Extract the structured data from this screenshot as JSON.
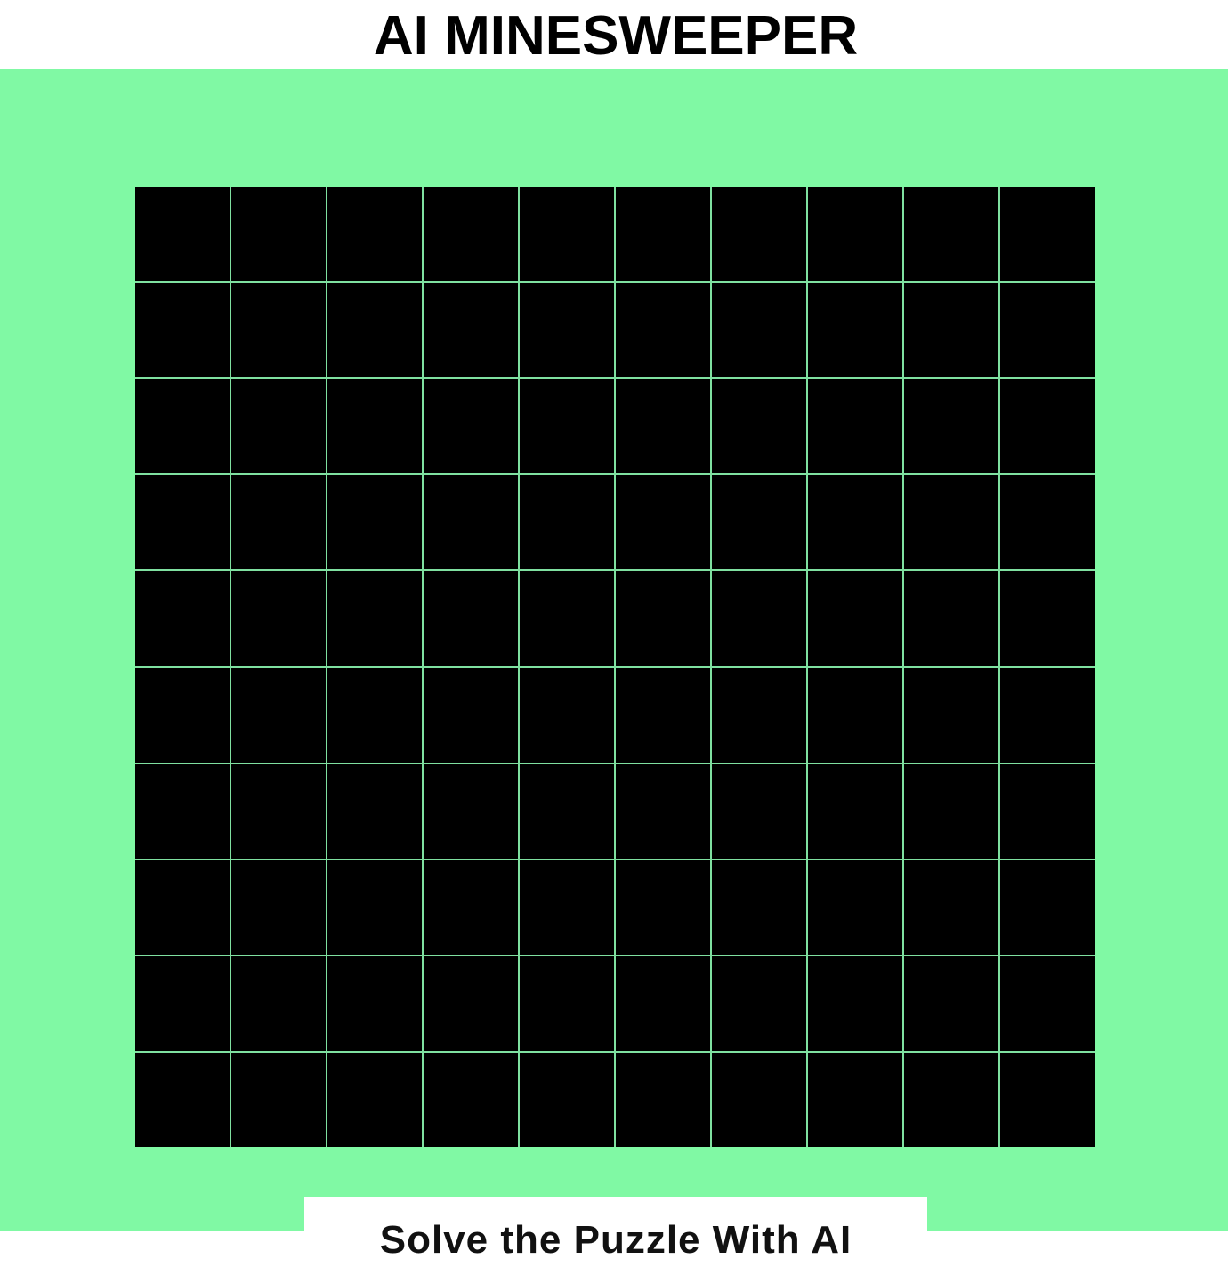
{
  "app": {
    "title": "AI MINESWEEPER"
  },
  "colors": {
    "panel_background": "#80f9a4",
    "cell_covered": "#000000",
    "grid_lines": "#7fe0a0",
    "button_background": "#ffffff"
  },
  "board": {
    "rows": 10,
    "columns": 10,
    "cells_state": "covered"
  },
  "controls": {
    "solve_label": "Solve the Puzzle With AI"
  }
}
